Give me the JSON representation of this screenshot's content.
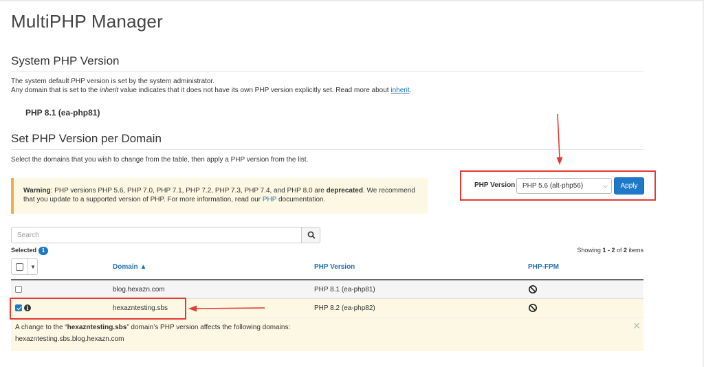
{
  "page": {
    "title": "MultiPHP Manager"
  },
  "system": {
    "heading": "System PHP Version",
    "line1": "The system default PHP version is set by the system administrator.",
    "line2_pre": "Any domain that is set to the ",
    "line2_em": "inherit",
    "line2_mid": " value indicates that it does not have its own PHP version explicitly set. Read more about ",
    "line2_link": "inherit",
    "line2_end": ".",
    "version": "PHP 8.1 (ea-php81)"
  },
  "per_domain": {
    "heading": "Set PHP Version per Domain",
    "description": "Select the domains that you wish to change from the table, then apply a PHP version from the list."
  },
  "warning": {
    "label": "Warning",
    "text1": ": PHP versions PHP 5.6, PHP 7.0, PHP 7.1, PHP 7.2, PHP 7.3, PHP 7.4, and PHP 8.0 are ",
    "deprecated": "deprecated",
    "text2": ". We recommend that you update to a supported version of PHP. For more information, read our ",
    "link": "PHP",
    "text3": " documentation."
  },
  "php_selector": {
    "label": "PHP Version",
    "selected": "PHP 5.6 (alt-php56)",
    "apply_label": "Apply"
  },
  "search": {
    "placeholder": "Search"
  },
  "selection": {
    "label": "Selected",
    "count": "1"
  },
  "pagination": {
    "prefix": "Showing ",
    "range": "1 - 2",
    "suffix": " of ",
    "total": "2",
    "unit": " items"
  },
  "table": {
    "columns": {
      "domain": "Domain ▲",
      "php_version": "PHP Version",
      "php_fpm": "PHP-FPM"
    },
    "rows": [
      {
        "domain": "blog.hexazn.com",
        "php_version": "PHP 8.1 (ea-php81)",
        "checked": false
      },
      {
        "domain": "hexazntesting.sbs",
        "php_version": "PHP 8.2 (ea-php82)",
        "checked": true
      }
    ]
  },
  "notice": {
    "pre": "A change to the “",
    "domain": "hexazntesting.sbs",
    "post": "” domain’s PHP version affects the following domains:",
    "affected": "hexazntesting.sbs.blog.hexazn.com"
  },
  "colors": {
    "accent": "#1f78c8",
    "annotation": "#e53935",
    "warning_bg": "#fcf8e3",
    "warning_border": "#f0ad4e"
  }
}
